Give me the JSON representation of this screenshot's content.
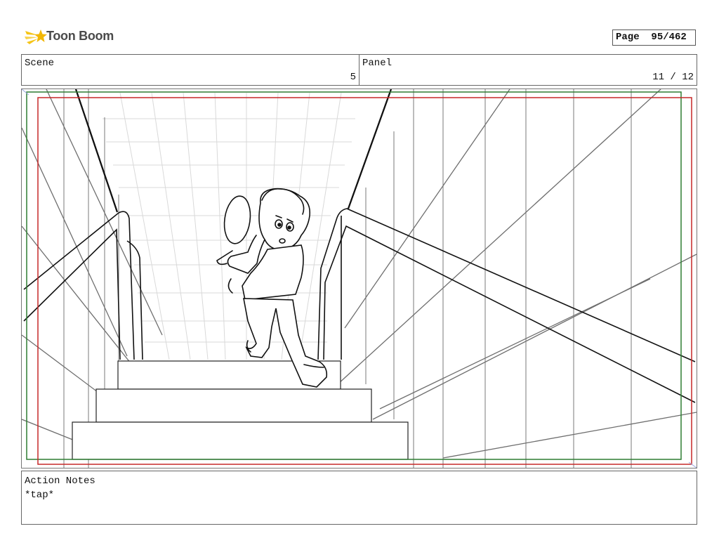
{
  "brand": {
    "name": "Toon Boom"
  },
  "page": {
    "label": "Page",
    "number": "95/462"
  },
  "scene": {
    "label": "Scene",
    "value": "5"
  },
  "panel": {
    "label": "Panel",
    "value": "11 / 12"
  },
  "notes": {
    "label": "Action Notes",
    "text": "*tap*"
  },
  "colors": {
    "safe_frame": "#2e7d32",
    "camera_frame": "#c62828",
    "logo_star": "#f5c518"
  }
}
